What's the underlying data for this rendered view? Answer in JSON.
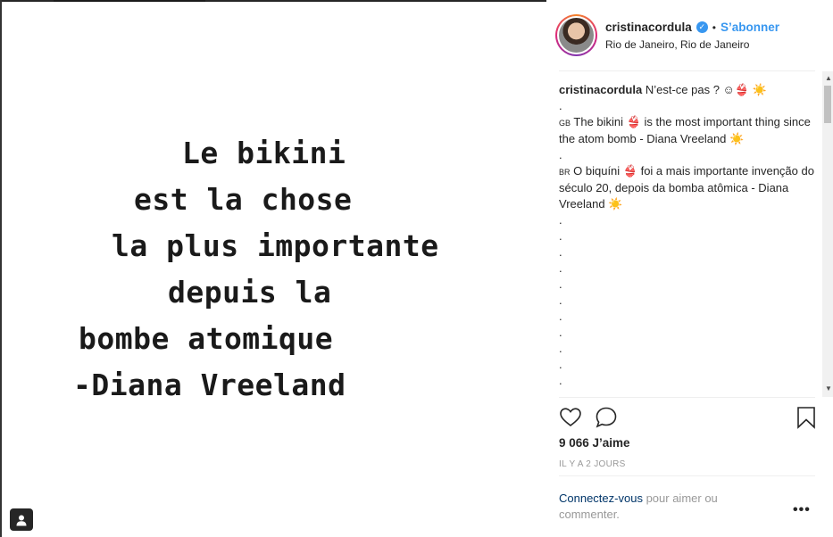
{
  "post_image": {
    "quote_lines": [
      "Le bikini",
      "est la chose",
      "la plus importante",
      "depuis la",
      "bombe atomique",
      "-Diana Vreeland"
    ]
  },
  "header": {
    "username": "cristinacordula",
    "follow_label": "S’abonner",
    "separator": "•",
    "location": "Rio de Janeiro, Rio de Janeiro"
  },
  "caption": {
    "username": "cristinacordula",
    "intro": "N’est-ce pas ? ☺👙 ☀️",
    "dot": ".",
    "english_flag": "GB",
    "english": "The bikini 👙 is the most important thing since the atom bomb - Diana Vreeland ☀️",
    "portuguese_flag": "BR",
    "portuguese": "O biquíni 👙 foi a mais importante invenção do século 20, depois da bomba atômica - Diana Vreeland ☀️"
  },
  "stats": {
    "likes": "9 066 J’aime",
    "time_ago": "IL Y A 2 JOURS"
  },
  "login": {
    "link": "Connectez-vous",
    "rest": " pour aimer ou commenter."
  },
  "more_label": "•••",
  "icons": {
    "like": "heart-icon",
    "comment": "comment-icon",
    "save": "bookmark-icon",
    "tag": "user-tag-icon",
    "verified": "verified-badge-icon"
  }
}
